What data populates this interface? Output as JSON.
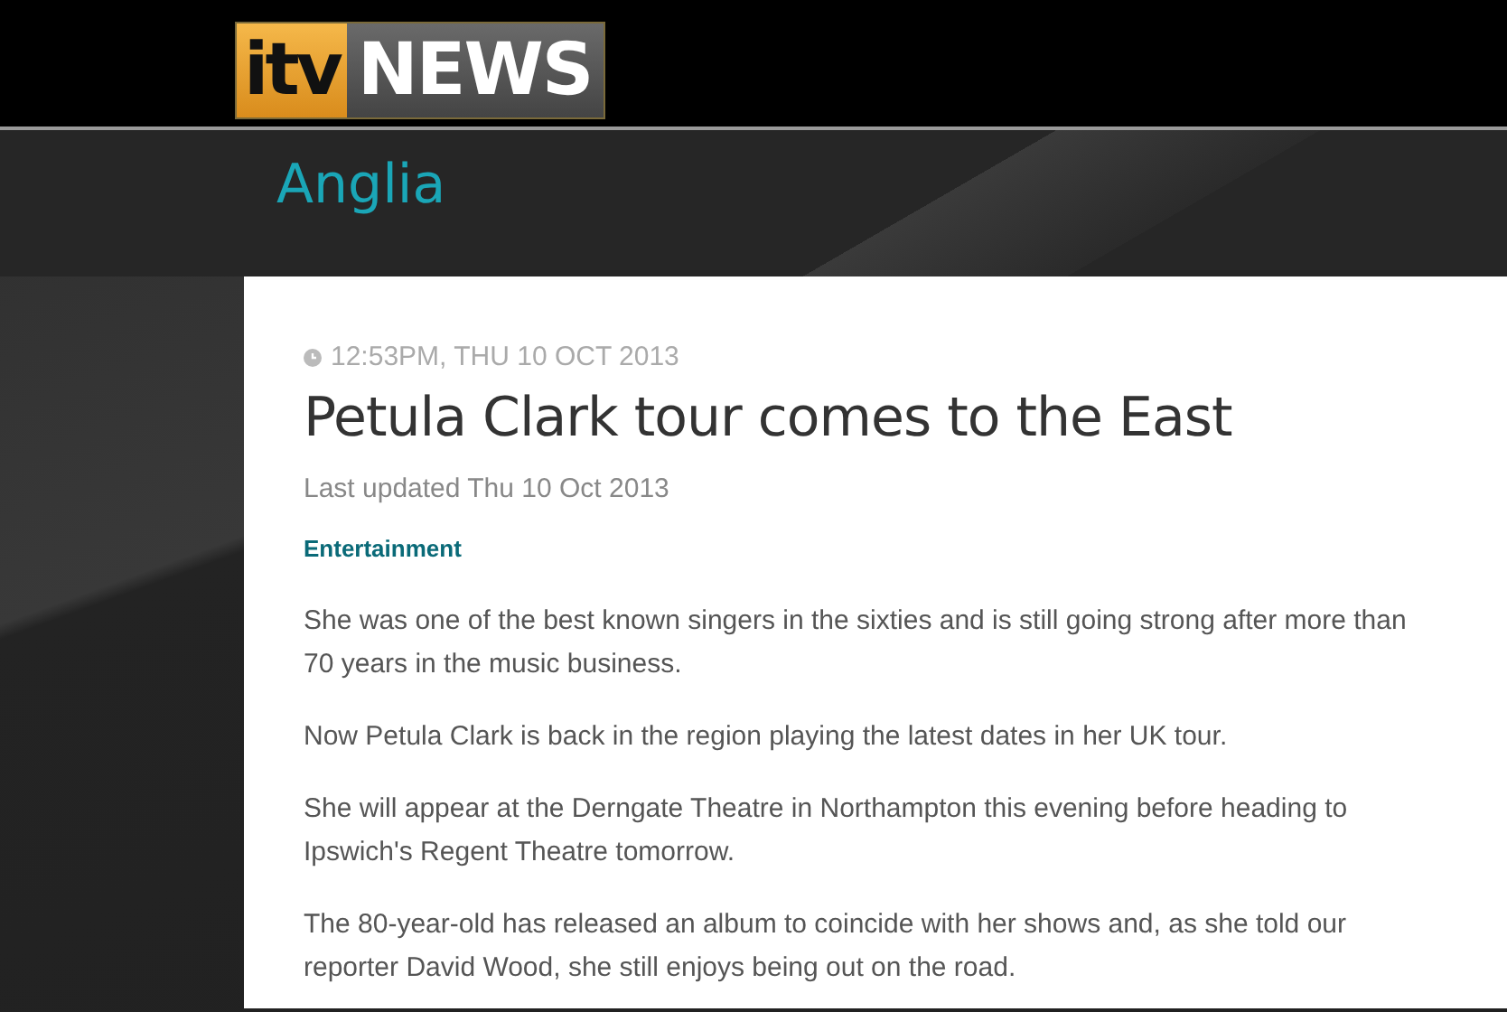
{
  "logo": {
    "part_1": "itv",
    "part_2": "NEWS"
  },
  "region": "Anglia",
  "article": {
    "timestamp": "12:53PM, THU 10 OCT 2013",
    "headline": "Petula Clark tour comes to the East",
    "updated": "Last updated Thu 10 Oct 2013",
    "category": "Entertainment",
    "paragraphs": [
      "She was one of the best known singers in the sixties and is still going strong after more than 70 years in the music business.",
      "Now Petula Clark is back in the region playing the latest dates in her UK tour.",
      "She will appear at the Derngate Theatre in Northampton this evening before heading to Ipswich's Regent Theatre tomorrow.",
      "The 80-year-old has released an album to coincide with her shows and, as she told our reporter David Wood, she still enjoys being out on the road."
    ]
  }
}
